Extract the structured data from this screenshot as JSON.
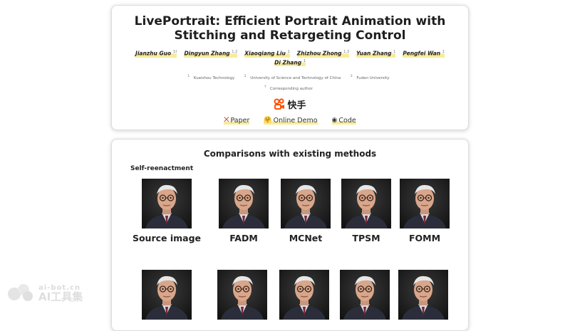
{
  "header": {
    "title": "LivePortrait: Efficient Portrait Animation with Stitching and Retargeting Control",
    "authors": [
      {
        "name": "Jianzhu Guo",
        "sup": "1†"
      },
      {
        "name": "Dingyun Zhang",
        "sup": "1,2"
      },
      {
        "name": "Xiaoqiang Liu",
        "sup": "1"
      },
      {
        "name": "Zhizhou Zhong",
        "sup": "1,3"
      },
      {
        "name": "Yuan Zhang",
        "sup": "1"
      },
      {
        "name": "Pengfei Wan",
        "sup": "1"
      },
      {
        "name": "Di Zhang",
        "sup": "1"
      }
    ],
    "affiliations": [
      {
        "sup": "1",
        "text": "Kuaishou Technology"
      },
      {
        "sup": "2",
        "text": "University of Science and Technology of China"
      },
      {
        "sup": "3",
        "text": "Fudan University"
      }
    ],
    "corresponding": {
      "sup": "†",
      "text": "Corresponding author"
    },
    "logo_text": "快手",
    "links": [
      {
        "icon": "⨉",
        "icon_name": "arxiv-icon",
        "label": "Paper"
      },
      {
        "icon": "🤗",
        "icon_name": "huggingface-icon",
        "label": "Online Demo"
      },
      {
        "icon": "◉",
        "icon_name": "github-icon",
        "label": "Code"
      }
    ]
  },
  "comparisons": {
    "title": "Comparisons with existing methods",
    "subsection": "Self-reenactment",
    "row1_labels": [
      "Source image",
      "FADM",
      "MCNet",
      "TPSM",
      "FOMM"
    ]
  },
  "watermark": {
    "top": "ai-bot.cn",
    "bottom": "AI工具集"
  },
  "colors": {
    "highlight": "#f7ec9c",
    "logo_orange": "#ff5000"
  }
}
